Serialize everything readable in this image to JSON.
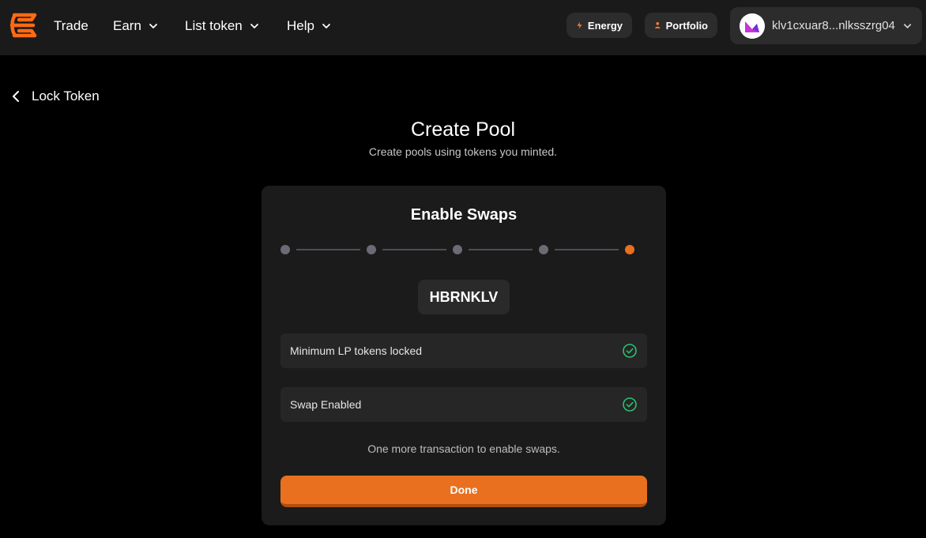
{
  "nav": {
    "items": [
      {
        "label": "Trade",
        "has_dropdown": false
      },
      {
        "label": "Earn",
        "has_dropdown": true
      },
      {
        "label": "List token",
        "has_dropdown": true
      },
      {
        "label": "Help",
        "has_dropdown": true
      }
    ],
    "energy_label": "Energy",
    "portfolio_label": "Portfolio",
    "wallet_address": "klv1cxuar8...nlksszrg04"
  },
  "back": {
    "label": "Lock Token"
  },
  "page": {
    "title": "Create Pool",
    "subtitle": "Create pools using tokens you minted."
  },
  "card": {
    "title": "Enable Swaps",
    "steps_total": 5,
    "current_step": 5,
    "token": "HBRNKLV",
    "statuses": [
      {
        "label": "Minimum LP tokens locked",
        "done": true
      },
      {
        "label": "Swap Enabled",
        "done": true
      }
    ],
    "note": "One more transaction to enable swaps.",
    "done_label": "Done"
  },
  "colors": {
    "accent": "#e8701f",
    "success": "#2fbf71",
    "background": "#000000",
    "card": "#1b1b1b"
  }
}
